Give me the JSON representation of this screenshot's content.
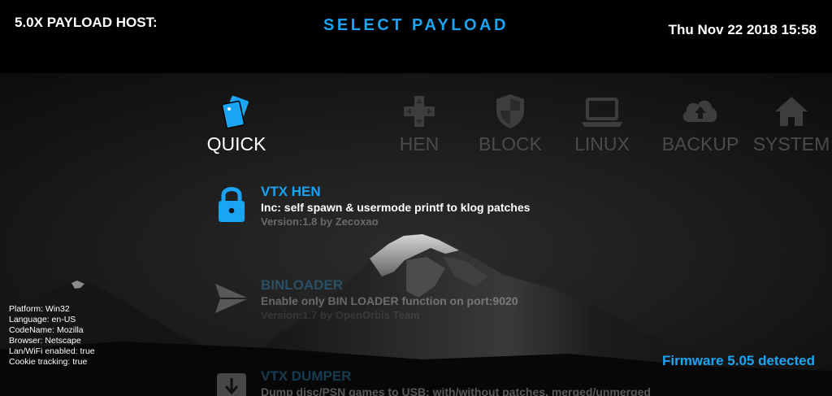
{
  "header": {
    "host_title": "5.0X PAYLOAD HOST:",
    "page_title": "SELECT PAYLOAD",
    "datetime": "Thu Nov 22 2018 15:58"
  },
  "tabs": [
    {
      "label": "QUICK",
      "icon": "cards-icon",
      "active": true
    },
    {
      "label": "HEN",
      "icon": "dpad-icon",
      "active": false
    },
    {
      "label": "BLOCK",
      "icon": "shield-icon",
      "active": false
    },
    {
      "label": "LINUX",
      "icon": "laptop-icon",
      "active": false
    },
    {
      "label": "BACKUP",
      "icon": "cloud-upload-icon",
      "active": false
    },
    {
      "label": "SYSTEM",
      "icon": "home-icon",
      "active": false
    }
  ],
  "payloads": [
    {
      "title": "VTX HEN",
      "description": "Inc: self spawn & usermode printf to klog patches",
      "version": "Version:1.8 by Zecoxao",
      "icon": "lock-icon"
    },
    {
      "title": "BINLOADER",
      "description": "Enable only BIN LOADER function on port:9020",
      "version": "Version:1.7 by OpenOrbis Team",
      "icon": "send-icon"
    },
    {
      "title": "VTX DUMPER",
      "description": "Dump disc/PSN games to USB: with/without patches, merged/unmerged",
      "version": "",
      "icon": "download-icon"
    }
  ],
  "info": {
    "platform": "Platform: Win32",
    "language": "Language: en-US",
    "codename": "CodeName: Mozilla",
    "browser": "Browser: Netscape",
    "lan": "Lan/WiFi enabled: true",
    "cookie": "Cookie tracking: true"
  },
  "firmware": "Firmware 5.05 detected",
  "colors": {
    "accent": "#1ba4f2",
    "inactive_tab": "#4b4b4b",
    "background": "#000000"
  }
}
